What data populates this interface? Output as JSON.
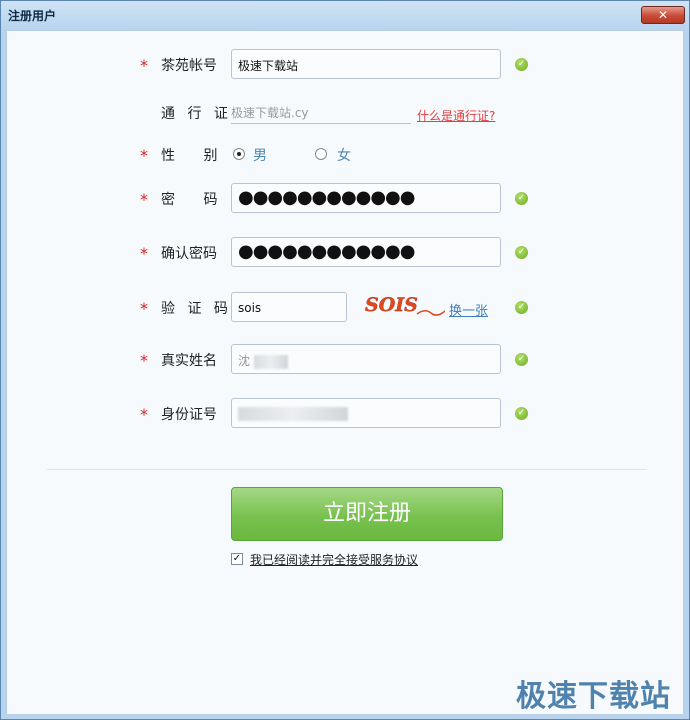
{
  "window": {
    "title": "注册用户",
    "close_glyph": "✕"
  },
  "form": {
    "account": {
      "label": "茶苑帐号",
      "value": "极速下载站"
    },
    "pass": {
      "label": "通 行 证",
      "placeholder": "极速下载站.cy",
      "link": "什么是通行证?"
    },
    "gender": {
      "label": "性 别",
      "options": [
        "男",
        "女"
      ],
      "selected": "男"
    },
    "password": {
      "label": "密 码",
      "value": "●●●●●●●●●●●●"
    },
    "confirm": {
      "label": "确认密码",
      "value": "●●●●●●●●●●●●"
    },
    "captcha": {
      "label": "验 证 码",
      "value": "sois",
      "image_text": "SOIS",
      "change_link": "换一张"
    },
    "realname": {
      "label": "真实姓名",
      "value_prefix": "沈"
    },
    "idcard": {
      "label": "身份证号",
      "value_prefix": ""
    }
  },
  "register_button": "立即注册",
  "agreement": {
    "checked": true,
    "text": "我已经阅读并完全接受服务协议"
  },
  "watermark": "极速下载站",
  "required_mark": "*",
  "ok_glyph": "✓",
  "colors": {
    "required": "#d62222",
    "link": "#3d80b8",
    "button": "#78c14f",
    "ok": "#68aa22"
  }
}
